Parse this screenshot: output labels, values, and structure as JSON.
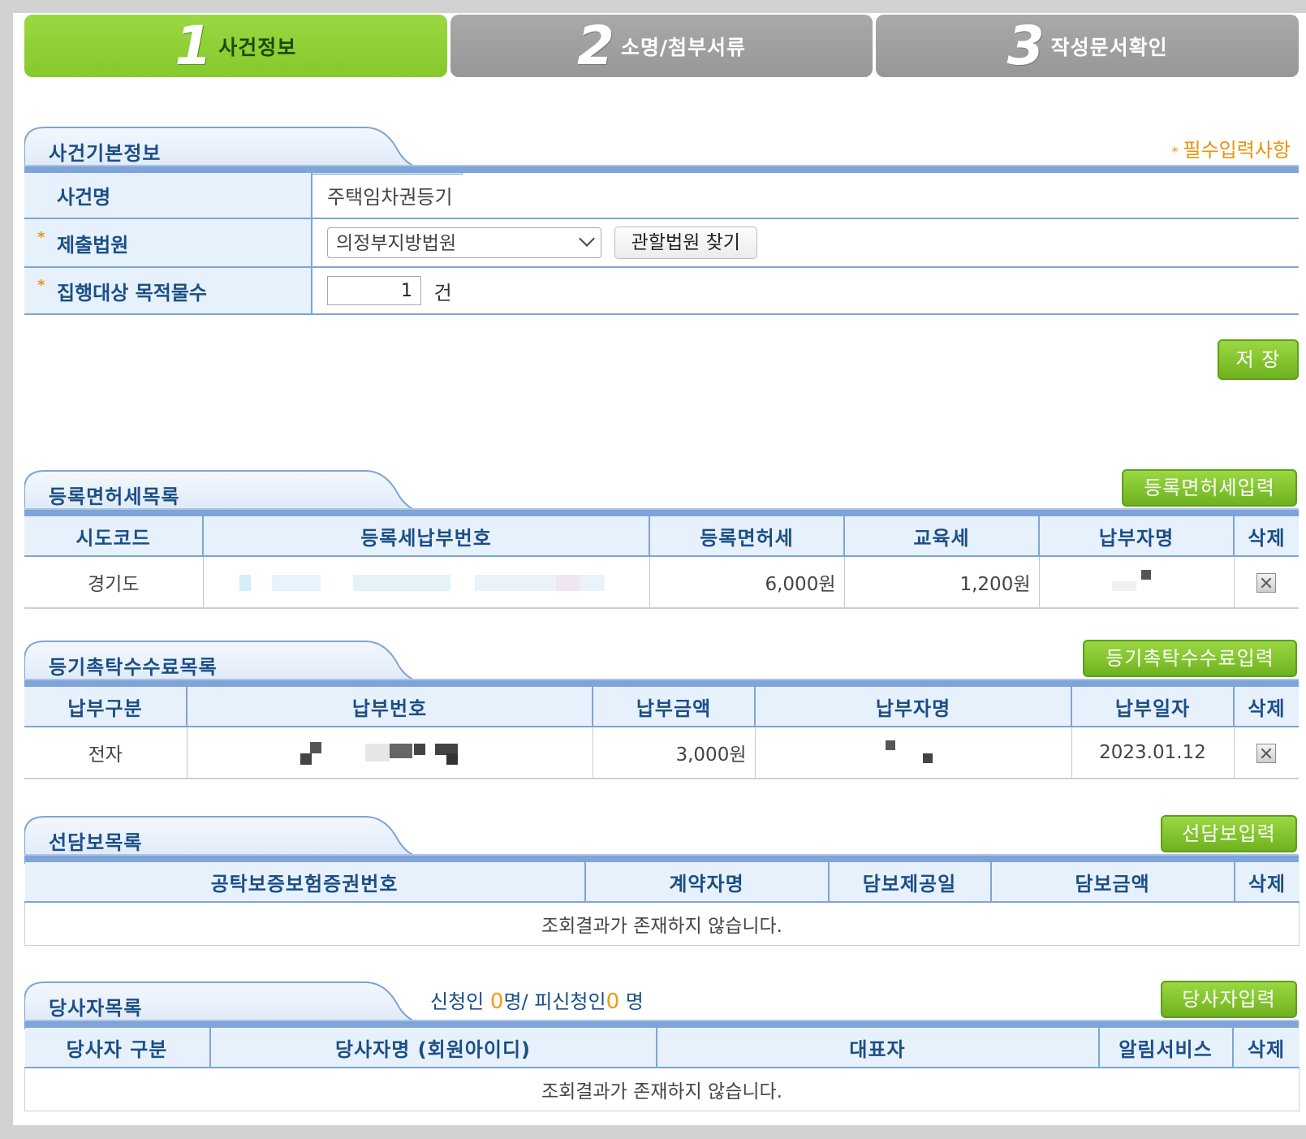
{
  "steps": [
    {
      "num": "1",
      "label": "사건정보",
      "active": true
    },
    {
      "num": "2",
      "label": "소명/첨부서류",
      "active": false
    },
    {
      "num": "3",
      "label": "작성문서확인",
      "active": false
    }
  ],
  "basic_info": {
    "title": "사건기본정보",
    "required_note": "필수입력사항",
    "case_name_label": "사건명",
    "case_name_value": "주택임차권등기",
    "court_label": "제출법원",
    "court_value": "의정부지방법원",
    "court_find_button": "관할법원 찾기",
    "object_count_label": "집행대상 목적물수",
    "object_count_value": "1",
    "object_count_unit": "건",
    "save_button": "저 장"
  },
  "registration_tax": {
    "title": "등록면허세목록",
    "input_button": "등록면허세입력",
    "columns": [
      "시도코드",
      "등록세납부번호",
      "등록면허세",
      "교육세",
      "납부자명",
      "삭제"
    ],
    "rows": [
      {
        "region": "경기도",
        "payment_no": "",
        "tax": "6,000원",
        "edu_tax": "1,200원",
        "payer": ""
      }
    ]
  },
  "commission_fee": {
    "title": "등기촉탁수수료목록",
    "input_button": "등기촉탁수수료입력",
    "columns": [
      "납부구분",
      "납부번호",
      "납부금액",
      "납부자명",
      "납부일자",
      "삭제"
    ],
    "rows": [
      {
        "type": "전자",
        "payment_no": "",
        "amount": "3,000원",
        "payer": "",
        "date": "2023.01.12"
      }
    ]
  },
  "collateral": {
    "title": "선담보목록",
    "input_button": "선담보입력",
    "columns": [
      "공탁보증보험증권번호",
      "계약자명",
      "담보제공일",
      "담보금액",
      "삭제"
    ],
    "empty_text": "조회결과가 존재하지 않습니다."
  },
  "parties": {
    "title": "당사자목록",
    "input_button": "당사자입력",
    "applicant_label": "신청인",
    "applicant_count": "0",
    "applicant_unit": "명/",
    "respondent_label": "피신청인",
    "respondent_count": "0",
    "respondent_unit": "명",
    "columns": [
      "당사자 구분",
      "당사자명 (회원아이디)",
      "대표자",
      "알림서비스",
      "삭제"
    ],
    "empty_text": "조회결과가 존재하지 않습니다."
  },
  "colors": {
    "active_step": "#8dce34",
    "inactive_step": "#a0a0a0",
    "header_text": "#1b4e87",
    "rule_blue": "#7ea4d8",
    "required_orange": "#e8930c",
    "button_green": "#7cbf2a"
  }
}
